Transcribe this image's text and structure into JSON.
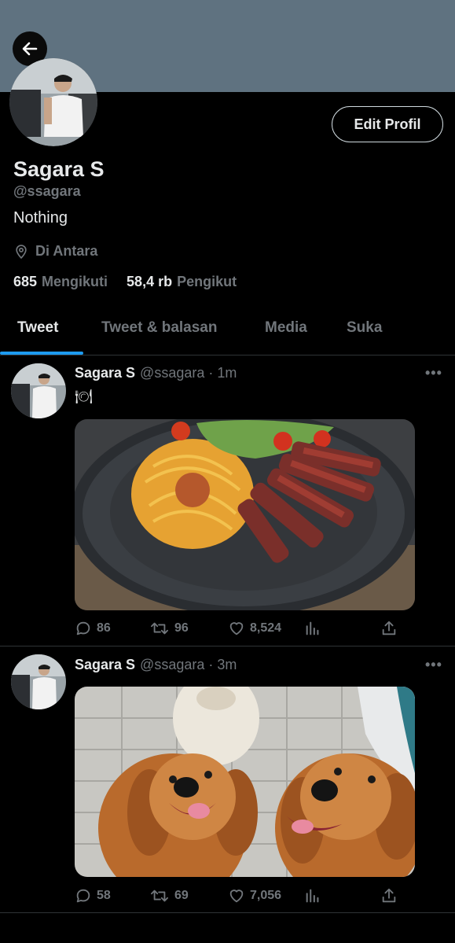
{
  "profile": {
    "name": "Sagara S",
    "handle": "@ssagara",
    "bio": "Nothing",
    "location": "Di Antara",
    "following_count": "685",
    "following_label": "Mengikuti",
    "followers_count": "58,4 rb",
    "followers_label": "Pengikut",
    "edit_label": "Edit Profil"
  },
  "tabs": [
    {
      "label": "Tweet",
      "active": true
    },
    {
      "label": "Tweet & balasan"
    },
    {
      "label": "Media"
    },
    {
      "label": "Suka"
    }
  ],
  "tweets": [
    {
      "name": "Sagara S",
      "meta": "@ssagara · 1m",
      "text": "🍽",
      "media": "plate of spaghetti with sliced steak",
      "replies": "86",
      "retweets": "96",
      "likes": "8,524"
    },
    {
      "name": "Sagara S",
      "meta": "@ssagara · 3m",
      "text": "",
      "media": "three golden retrievers smiling",
      "replies": "58",
      "retweets": "69",
      "likes": "7,056"
    }
  ],
  "icons": {
    "back": "arrow-left-icon",
    "location": "map-pin-icon",
    "more": "more-horizontal-icon",
    "reply": "reply-icon",
    "retweet": "retweet-icon",
    "like": "heart-icon",
    "views": "analytics-icon",
    "share": "share-icon"
  },
  "colors": {
    "banner": "#5f7280",
    "accent": "#1d9bf0",
    "muted": "#71767b"
  }
}
